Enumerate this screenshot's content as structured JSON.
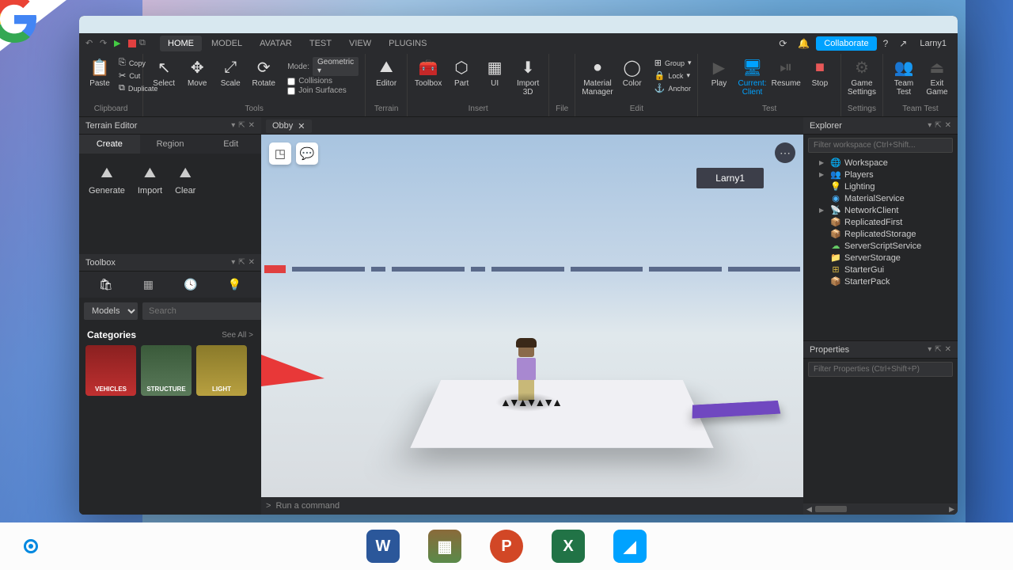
{
  "menubar": {
    "tabs": [
      "HOME",
      "MODEL",
      "AVATAR",
      "TEST",
      "VIEW",
      "PLUGINS"
    ],
    "activeTab": "HOME",
    "collaborate": "Collaborate",
    "username": "Larny1"
  },
  "ribbon": {
    "clipboard": {
      "label": "Clipboard",
      "paste": "Paste",
      "copy": "Copy",
      "cut": "Cut",
      "duplicate": "Duplicate"
    },
    "tools": {
      "label": "Tools",
      "select": "Select",
      "move": "Move",
      "scale": "Scale",
      "rotate": "Rotate",
      "modeLabel": "Mode:",
      "modeValue": "Geometric",
      "collisions": "Collisions",
      "joinSurfaces": "Join Surfaces"
    },
    "terrain": {
      "label": "Terrain",
      "editor": "Editor"
    },
    "insert": {
      "label": "Insert",
      "toolbox": "Toolbox",
      "part": "Part",
      "ui": "UI",
      "import3d": "Import\n3D"
    },
    "file": {
      "label": "File"
    },
    "edit": {
      "label": "Edit",
      "material": "Material\nManager",
      "color": "Color",
      "group": "Group",
      "lock": "Lock",
      "anchor": "Anchor"
    },
    "test": {
      "label": "Test",
      "play": "Play",
      "current": "Current:\nClient",
      "resume": "Resume",
      "stop": "Stop"
    },
    "settings": {
      "label": "Settings",
      "game": "Game\nSettings"
    },
    "teamtest": {
      "label": "Team Test",
      "team": "Team\nTest",
      "exit": "Exit\nGame"
    }
  },
  "terrainEditor": {
    "title": "Terrain Editor",
    "tabs": [
      "Create",
      "Region",
      "Edit"
    ],
    "activeTab": "Create",
    "generate": "Generate",
    "import": "Import",
    "clear": "Clear"
  },
  "toolbox": {
    "title": "Toolbox",
    "dropdown": "Models",
    "searchPlaceholder": "Search",
    "categoriesHeader": "Categories",
    "seeAll": "See All >",
    "categories": [
      "VEHICLES",
      "STRUCTURE",
      "LIGHT"
    ]
  },
  "docTab": "Obby",
  "viewport": {
    "nametag": "Larny1"
  },
  "commandBar": {
    "placeholder": "Run a command"
  },
  "explorer": {
    "title": "Explorer",
    "filterPlaceholder": "Filter workspace (Ctrl+Shift...",
    "nodes": [
      {
        "icon": "🌐",
        "color": "#4ab4ff",
        "label": "Workspace",
        "arrow": true
      },
      {
        "icon": "👥",
        "color": "#ff8844",
        "label": "Players",
        "arrow": true
      },
      {
        "icon": "💡",
        "color": "#ffdd44",
        "label": "Lighting"
      },
      {
        "icon": "◉",
        "color": "#4ab4ff",
        "label": "MaterialService"
      },
      {
        "icon": "📡",
        "color": "#4ab4ff",
        "label": "NetworkClient",
        "arrow": true
      },
      {
        "icon": "📦",
        "color": "#cc8866",
        "label": "ReplicatedFirst"
      },
      {
        "icon": "📦",
        "color": "#88cc88",
        "label": "ReplicatedStorage"
      },
      {
        "icon": "☁",
        "color": "#66cc66",
        "label": "ServerScriptService"
      },
      {
        "icon": "📁",
        "color": "#cc8866",
        "label": "ServerStorage"
      },
      {
        "icon": "⊞",
        "color": "#ddbb44",
        "label": "StarterGui"
      },
      {
        "icon": "📦",
        "color": "#ddbb44",
        "label": "StarterPack"
      }
    ]
  },
  "properties": {
    "title": "Properties",
    "filterPlaceholder": "Filter Properties (Ctrl+Shift+P)"
  },
  "taskbarApps": [
    "W",
    "▦",
    "P",
    "X",
    "◢"
  ]
}
